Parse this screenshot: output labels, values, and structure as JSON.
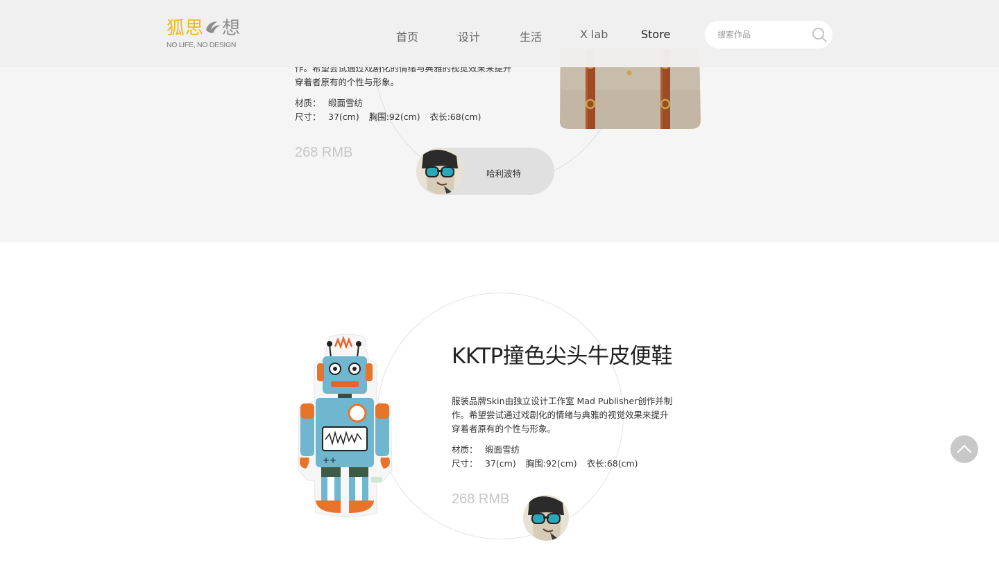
{
  "brand": {
    "logo_cn_1": "狐思",
    "logo_cn_2": "想",
    "logo_sub": "NO LIFE, NO DESIGN",
    "accent_color": "#f1b81c"
  },
  "nav": {
    "items": [
      "首页",
      "设计",
      "生活",
      "X lab",
      "Store"
    ],
    "active": "Store"
  },
  "search": {
    "placeholder": "搜索作品",
    "icon": "search-icon"
  },
  "product1": {
    "desc_partial": "作。希望尝试通过戏剧化的情绪与典雅的视觉效果来提升穿着者原有的个性与形象。",
    "material_label": "材质：",
    "material_value": "缎面雪纺",
    "size_label": "尺寸：",
    "size_values": [
      "37(cm)",
      "胸围:92(cm)",
      "衣长:68(cm)"
    ],
    "price": "268 RMB",
    "author": "哈利波特",
    "image": "canvas-bag-image"
  },
  "product2": {
    "title": "KKTP撞色尖头牛皮便鞋",
    "desc": "服装品牌Skin由独立设计工作室 Mad Publisher创作并制作。希望尝试通过戏剧化的情绪与典雅的视觉效果来提升穿着者原有的个性与形象。",
    "material_label": "材质：",
    "material_value": "缎面雪纺",
    "size_label": "尺寸：",
    "size_values": [
      "37(cm)",
      "胸围:92(cm)",
      "衣长:68(cm)"
    ],
    "price": "268 RMB",
    "image": "robot-pillow-image"
  },
  "back_to_top": {
    "icon": "chevron-up-icon"
  }
}
